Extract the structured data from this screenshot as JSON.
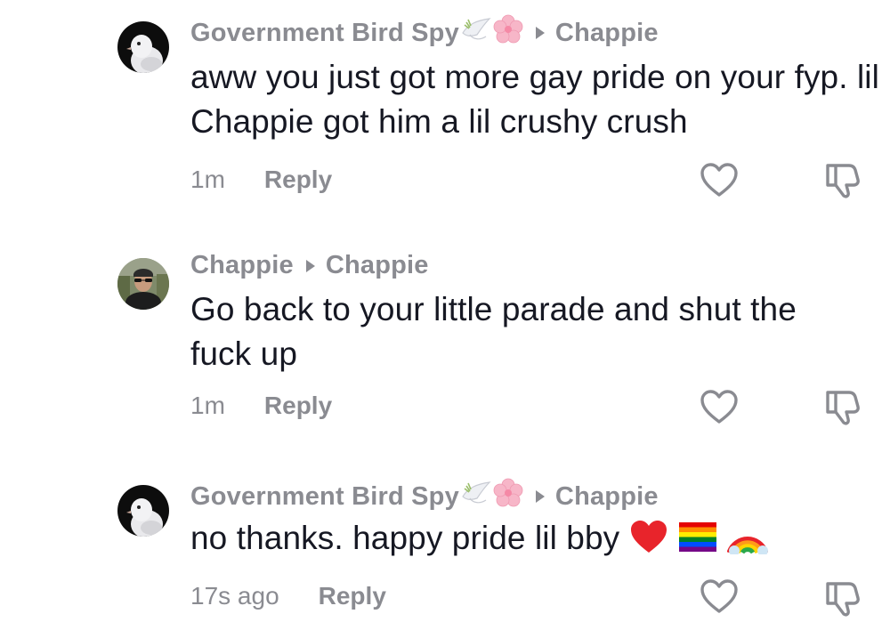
{
  "comments": [
    {
      "author": "Government Bird Spy",
      "reply_to": "Chappie",
      "text": "aww you just got more gay pride on your fyp. lil Chappie got him a lil crushy crush",
      "time": "1m",
      "reply_label": "Reply",
      "avatar": "pigeon-avatar",
      "name_emojis": [
        "dove-emoji",
        "cherry-blossom-emoji"
      ]
    },
    {
      "author": "Chappie",
      "reply_to": "Chappie",
      "text": "Go back to your little parade and shut the fuck up",
      "time": "1m",
      "reply_label": "Reply",
      "avatar": "person-avatar"
    },
    {
      "author": "Government Bird Spy",
      "reply_to": "Chappie",
      "text": "no thanks. happy pride lil bby",
      "text_emojis": [
        "red-heart-emoji",
        "rainbow-flag-emoji",
        "rainbow-emoji"
      ],
      "time": "17s ago",
      "reply_label": "Reply",
      "avatar": "pigeon-avatar",
      "name_emojis": [
        "dove-emoji",
        "cherry-blossom-emoji"
      ]
    }
  ],
  "colors": {
    "text": "#161823",
    "secondary": "#8a8b91",
    "heart_red": "#e8242b"
  }
}
